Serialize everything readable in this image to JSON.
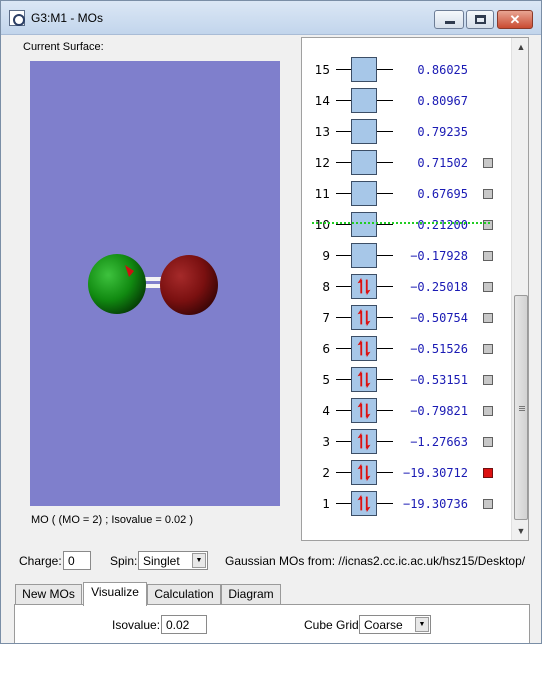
{
  "window": {
    "title": "G3:M1 - MOs"
  },
  "surface": {
    "label": "Current Surface:",
    "caption": "MO ( (MO = 2) ; Isovalue = 0.02 )"
  },
  "orbitals": [
    {
      "index": "15",
      "energy": "0.86025",
      "occupied": false,
      "checkbox": null
    },
    {
      "index": "14",
      "energy": "0.80967",
      "occupied": false,
      "checkbox": null
    },
    {
      "index": "13",
      "energy": "0.79235",
      "occupied": false,
      "checkbox": null
    },
    {
      "index": "12",
      "energy": "0.71502",
      "occupied": false,
      "checkbox": "off"
    },
    {
      "index": "11",
      "energy": "0.67695",
      "occupied": false,
      "checkbox": "off"
    },
    {
      "index": "10",
      "energy": "0.21200",
      "occupied": false,
      "checkbox": "off"
    },
    {
      "index": "9",
      "energy": "−0.17928",
      "occupied": false,
      "checkbox": "off"
    },
    {
      "index": "8",
      "energy": "−0.25018",
      "occupied": true,
      "checkbox": "off"
    },
    {
      "index": "7",
      "energy": "−0.50754",
      "occupied": true,
      "checkbox": "off"
    },
    {
      "index": "6",
      "energy": "−0.51526",
      "occupied": true,
      "checkbox": "off"
    },
    {
      "index": "5",
      "energy": "−0.53151",
      "occupied": true,
      "checkbox": "off"
    },
    {
      "index": "4",
      "energy": "−0.79821",
      "occupied": true,
      "checkbox": "off"
    },
    {
      "index": "3",
      "energy": "−1.27663",
      "occupied": true,
      "checkbox": "off"
    },
    {
      "index": "2",
      "energy": "−19.30712",
      "occupied": true,
      "checkbox": "on"
    },
    {
      "index": "1",
      "energy": "−19.30736",
      "occupied": true,
      "checkbox": "off"
    }
  ],
  "controls": {
    "charge_label": "Charge:",
    "charge_value": "0",
    "spin_label": "Spin:",
    "spin_value": "Singlet",
    "source_text": "Gaussian MOs from:  //icnas2.cc.ic.ac.uk/hsz15/Desktop/"
  },
  "tabs": [
    "New MOs",
    "Visualize",
    "Calculation",
    "Diagram"
  ],
  "active_tab": "Visualize",
  "visualize": {
    "isovalue_label": "Isovalue:",
    "isovalue": "0.02",
    "cube_grid_label": "Cube Grid:",
    "cube_grid": "Coarse"
  },
  "colors": {
    "viewport_bg": "#7f7fcc",
    "orbital_box": "#a7c7e8",
    "energy_text": "#1a1ab4",
    "homo_lumo_line": "#22cc22",
    "selected_checkbox": "#dd1111",
    "lobe_green": "#118a11",
    "lobe_red": "#7a1010"
  },
  "icons": {
    "app": "gaussview-app-icon",
    "minimize": "minimize-icon",
    "maximize": "maximize-icon",
    "close": "close-icon"
  }
}
